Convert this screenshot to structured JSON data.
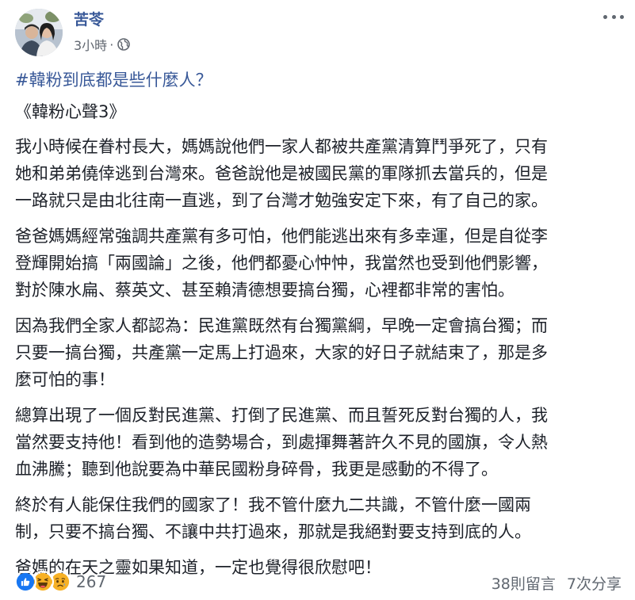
{
  "post": {
    "author": "苦苓",
    "timestamp": "3小時",
    "separator": "·",
    "privacy_icon": "globe-icon",
    "menu_icon": "more-options-icon",
    "hashtag": "#韓粉到底都是些什麼人？",
    "title": "《韓粉心聲3》",
    "paragraphs": [
      [
        "我小時候在眷村長大，媽媽說他們一家人都被共產黨清算鬥爭死了，只有",
        "她和弟弟僥倖逃到台灣來。爸爸說他是被國民黨的軍隊抓去當兵的，但是",
        "一路就只是由北往南一直逃，到了台灣才勉強安定下來，有了自己的家。"
      ],
      [
        "爸爸媽媽經常強調共產黨有多可怕，他們能逃出來有多幸運，但是自從李",
        "登輝開始搞「兩國論」之後，他們都憂心忡忡，我當然也受到他們影響，",
        "對於陳水扁、蔡英文、甚至賴清德想要搞台獨，心裡都非常的害怕。"
      ],
      [
        "因為我們全家人都認為：民進黨既然有台獨黨綱，早晚一定會搞台獨；而",
        "只要一搞台獨，共產黨一定馬上打過來，大家的好日子就結束了，那是多",
        "麼可怕的事！"
      ],
      [
        "總算出現了一個反對民進黨、打倒了民進黨、而且誓死反對台獨的人，我",
        "當然要支持他！看到他的造勢場合，到處揮舞著許久不見的國旗，令人熱",
        "血沸騰；聽到他說要為中華民國粉身碎骨，我更是感動的不得了。"
      ],
      [
        "終於有人能保住我們的國家了！我不管什麼九二共識，不管什麼一國兩",
        "制，只要不搞台獨、不讓中共打過來，那就是我絕對要支持到底的人。"
      ],
      [
        "爸媽的在天之靈如果知道，一定也覺得很欣慰吧！"
      ]
    ]
  },
  "footer": {
    "reactions": [
      "like-icon",
      "haha-icon",
      "sad-icon"
    ],
    "reaction_count": "267",
    "comments": "38則留言",
    "shares": "7次分享"
  },
  "colors": {
    "link": "#385898",
    "meta": "#616770",
    "like": "#1877f2",
    "emoji": "#f7b125"
  }
}
